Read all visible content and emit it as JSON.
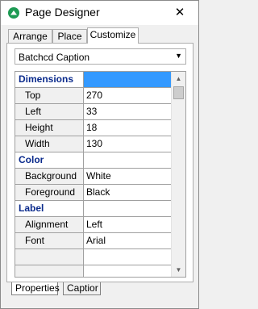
{
  "window": {
    "title": "Page Designer",
    "close_glyph": "✕"
  },
  "tabs": [
    {
      "label": "Arrange"
    },
    {
      "label": "Place"
    },
    {
      "label": "Customize"
    }
  ],
  "active_tab": "Customize",
  "object_selector": {
    "value": "Batchcd Caption",
    "arrow": "▼"
  },
  "properties": {
    "sections": [
      {
        "name": "Dimensions",
        "rows": [
          {
            "name": "Top",
            "value": "270"
          },
          {
            "name": "Left",
            "value": "33"
          },
          {
            "name": "Height",
            "value": "18"
          },
          {
            "name": "Width",
            "value": "130"
          }
        ]
      },
      {
        "name": "Color",
        "rows": [
          {
            "name": "Background",
            "value": "White"
          },
          {
            "name": "Foreground",
            "value": "Black"
          }
        ]
      },
      {
        "name": "Label",
        "rows": [
          {
            "name": "Alignment",
            "value": "Left"
          },
          {
            "name": "Font",
            "value": "Arial"
          }
        ]
      }
    ]
  },
  "scrollbar": {
    "up": "▲",
    "down": "▼"
  },
  "bottom_tabs": [
    {
      "label": "Properties"
    },
    {
      "label": "Captior"
    }
  ],
  "colors": {
    "section_text": "#0a2a8c",
    "selection": "#3399ff",
    "app_icon": "#1d9a53"
  }
}
